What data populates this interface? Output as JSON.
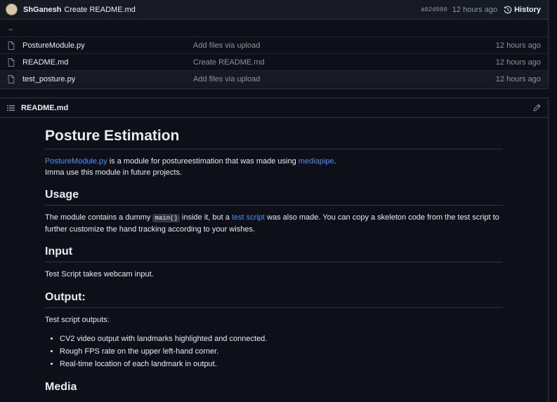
{
  "commit": {
    "author": "ShGanesh",
    "message": "Create README.md",
    "sha": "a02d988",
    "time": "12 hours ago",
    "history_label": "History"
  },
  "parent_dir": "..",
  "files": [
    {
      "name": "PostureModule.py",
      "message": "Add files via upload",
      "time": "12 hours ago"
    },
    {
      "name": "README.md",
      "message": "Create README.md",
      "time": "12 hours ago"
    },
    {
      "name": "test_posture.py",
      "message": "Add files via upload",
      "time": "12 hours ago"
    }
  ],
  "readme": {
    "filename": "README.md",
    "title": "Posture Estimation",
    "intro": {
      "link1": "PostureModule.py",
      "text1": " is a module for postureestimation that was made using ",
      "link2": "mediapipe",
      "text2": ".",
      "line2": "Imma use this module in future projects."
    },
    "usage": {
      "heading": "Usage",
      "text1": "The module contains a dummy ",
      "code": "main()",
      "text2": " inside it, but a ",
      "link": "test script",
      "text3": " was also made. You can copy a skeleton code from the test script to further customize the hand tracking according to your wishes."
    },
    "input": {
      "heading": "Input",
      "text": "Test Script takes webcam input."
    },
    "output": {
      "heading": "Output:",
      "text": "Test script outputs:",
      "items": [
        "CV2 video output with landmarks highlighted and connected.",
        "Rough FPS rate on the upper left-hand corner.",
        "Real-time location of each landmark in output."
      ]
    },
    "media_heading": "Media"
  }
}
